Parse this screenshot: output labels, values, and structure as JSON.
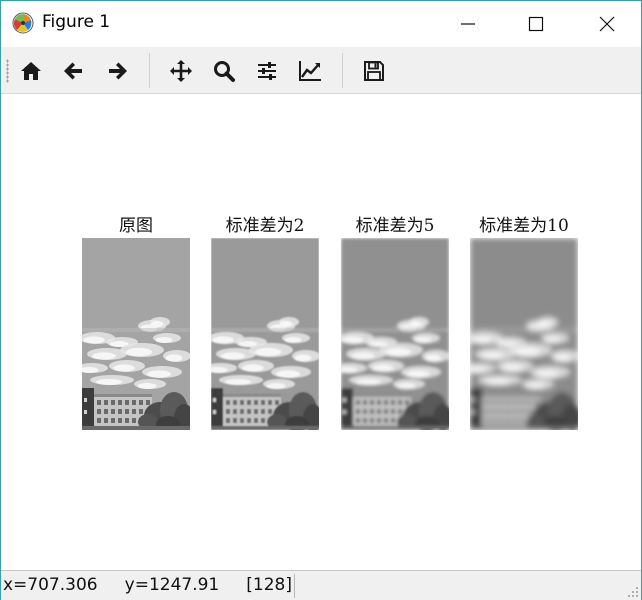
{
  "window": {
    "title": "Figure 1"
  },
  "toolbar": {
    "buttons": [
      {
        "icon": "home-icon"
      },
      {
        "icon": "arrow-left-icon"
      },
      {
        "icon": "arrow-right-icon"
      },
      {
        "icon": "move-icon"
      },
      {
        "icon": "zoom-icon"
      },
      {
        "icon": "sliders-icon"
      },
      {
        "icon": "line-chart-icon"
      },
      {
        "icon": "save-icon"
      }
    ]
  },
  "figure": {
    "panels": [
      {
        "title": "原图",
        "blur": 0
      },
      {
        "title": "标准差为2",
        "blur": 2
      },
      {
        "title": "标准差为5",
        "blur": 5
      },
      {
        "title": "标准差为10",
        "blur": 10
      }
    ]
  },
  "status": {
    "x": "x=707.306",
    "y": "y=1247.91",
    "value": "[128]"
  },
  "colors": {
    "window_border": "#3aa0a8",
    "toolbar_bg": "#f0f0f0",
    "icon": "#1a1a1a"
  }
}
